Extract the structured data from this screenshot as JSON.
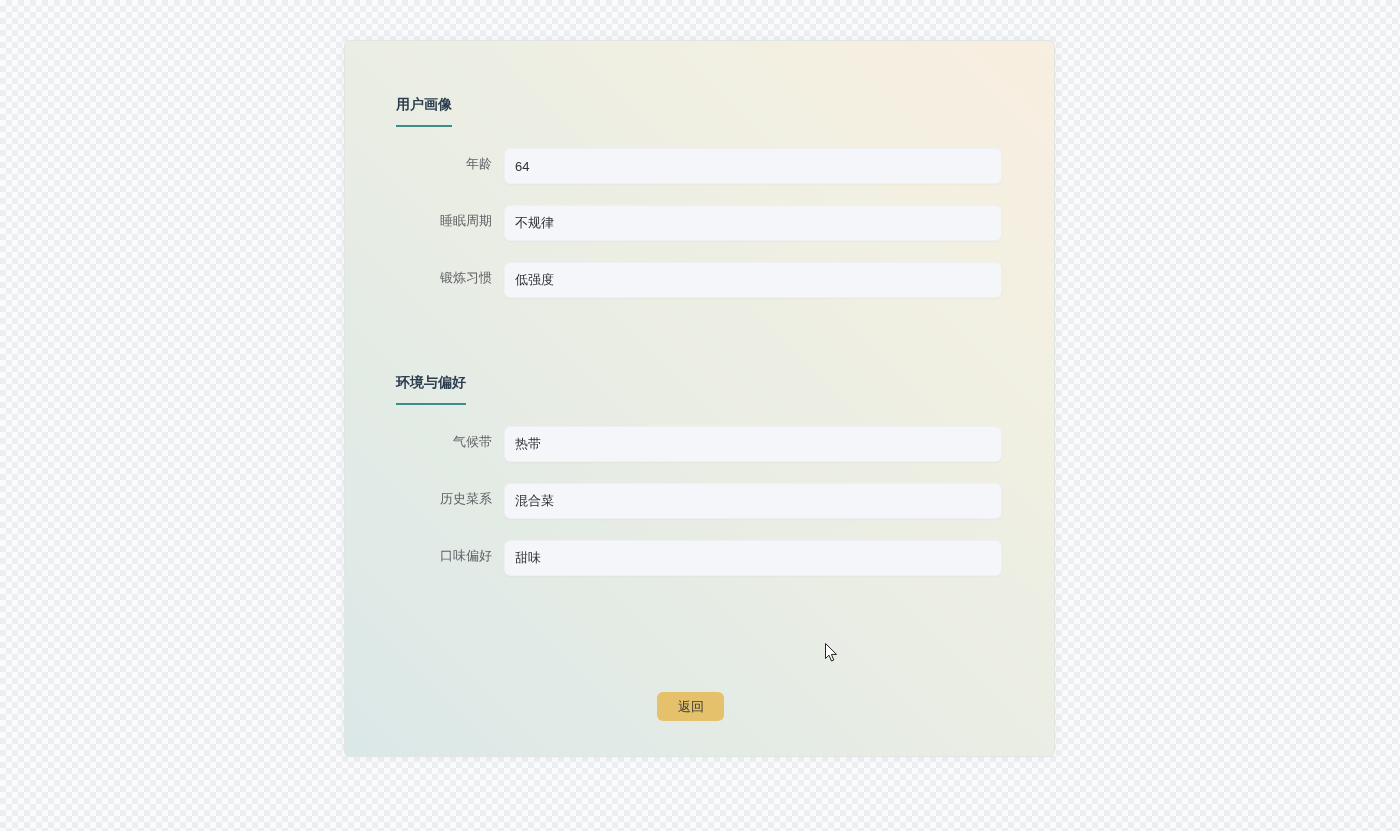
{
  "sections": [
    {
      "title": "用户画像",
      "fields": [
        {
          "label": "年龄",
          "value": "64"
        },
        {
          "label": "睡眠周期",
          "value": "不规律"
        },
        {
          "label": "锻炼习惯",
          "value": "低强度"
        }
      ]
    },
    {
      "title": "环境与偏好",
      "fields": [
        {
          "label": "气候带",
          "value": "热带"
        },
        {
          "label": "历史菜系",
          "value": "混合菜"
        },
        {
          "label": "口味偏好",
          "value": "甜味"
        }
      ]
    }
  ],
  "buttons": [
    {
      "label": "返回"
    }
  ]
}
